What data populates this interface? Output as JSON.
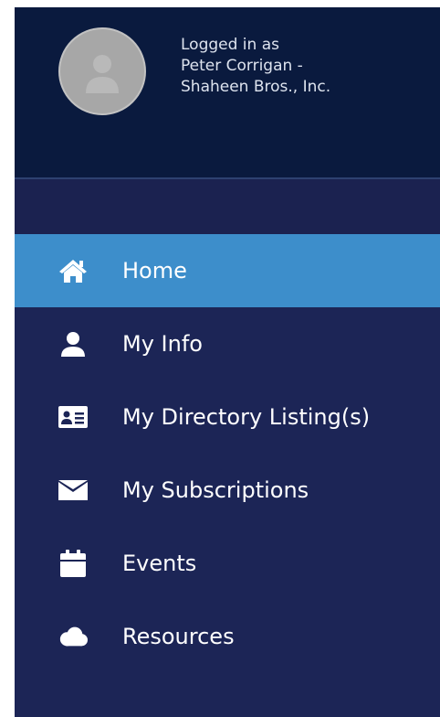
{
  "profile": {
    "line1": "Logged in as",
    "line2": "Peter Corrigan -",
    "line3": "Shaheen Bros., Inc.",
    "avatar_icon": "user-silhouette-icon"
  },
  "nav": {
    "items": [
      {
        "label": "Home",
        "icon": "home-icon",
        "active": true
      },
      {
        "label": "My Info",
        "icon": "user-icon",
        "active": false
      },
      {
        "label": "My Directory Listing(s)",
        "icon": "id-card-icon",
        "active": false
      },
      {
        "label": "My Subscriptions",
        "icon": "envelope-icon",
        "active": false
      },
      {
        "label": "Events",
        "icon": "calendar-icon",
        "active": false
      },
      {
        "label": "Resources",
        "icon": "cloud-icon",
        "active": false
      }
    ]
  },
  "colors": {
    "sidebar_bg": "#1c2556",
    "profile_bg": "#0a1a3e",
    "active_bg": "#3d8ecb",
    "text": "#ffffff"
  }
}
